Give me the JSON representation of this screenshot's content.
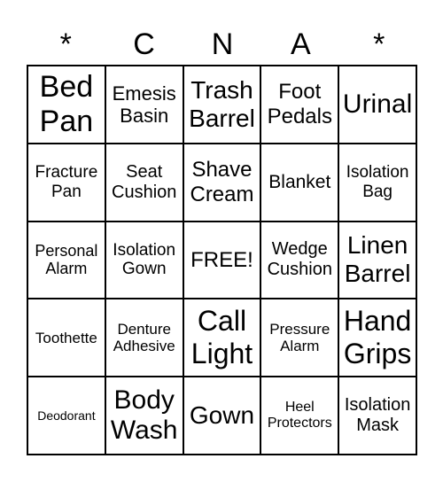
{
  "header": [
    "*",
    "C",
    "N",
    "A",
    "*"
  ],
  "cells": [
    [
      "Bed Pan",
      "Emesis Basin",
      "Trash Barrel",
      "Foot Pedals",
      "Urinal"
    ],
    [
      "Fracture Pan",
      "Seat Cushion",
      "Shave Cream",
      "Blanket",
      "Isolation Bag"
    ],
    [
      "Personal Alarm",
      "Isolation Gown",
      "FREE!",
      "Wedge Cushion",
      "Linen Barrel"
    ],
    [
      "Toothette",
      "Denture Adhesive",
      "Call Light",
      "Pressure Alarm",
      "Hand Grips"
    ],
    [
      "Deodorant",
      "Body Wash",
      "Gown",
      "Heel Protectors",
      "Isolation Mask"
    ]
  ]
}
